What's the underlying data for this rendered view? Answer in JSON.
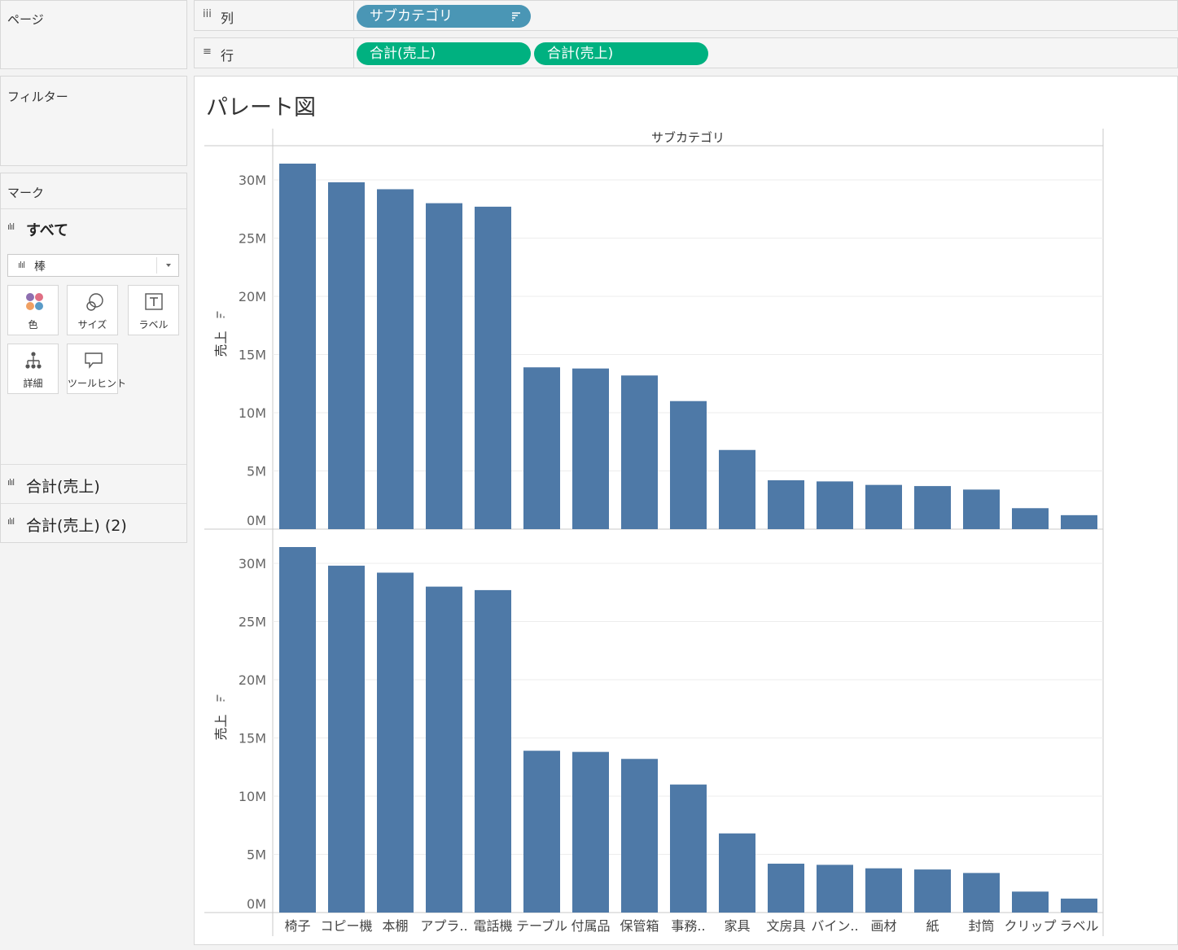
{
  "pages_panel": {
    "title": "ページ"
  },
  "filters_panel": {
    "title": "フィルター"
  },
  "marks_panel": {
    "title": "マーク",
    "all_label": "すべて",
    "mark_type": "棒",
    "buttons": [
      {
        "label": "色",
        "icon": "color-icon"
      },
      {
        "label": "サイズ",
        "icon": "size-icon"
      },
      {
        "label": "ラベル",
        "icon": "label-icon"
      },
      {
        "label": "詳細",
        "icon": "detail-icon"
      },
      {
        "label": "ツールヒント",
        "icon": "tooltip-icon"
      }
    ],
    "measure_cards": [
      "合計(売上)",
      "合計(売上) (2)"
    ]
  },
  "columns_shelf": {
    "label": "列",
    "pills": [
      "サブカテゴリ"
    ]
  },
  "rows_shelf": {
    "label": "行",
    "pills": [
      "合計(売上)",
      "合計(売上)"
    ]
  },
  "sheet_title": "パレート図",
  "colors": {
    "bar": "#4e79a7",
    "pill_dim": "#4a96b5",
    "pill_measure": "#00b180"
  },
  "chart_data": {
    "type": "bar",
    "header": "サブカテゴリ",
    "categories": [
      "椅子",
      "コピー機",
      "本棚",
      "アプラ..",
      "電話機",
      "テーブル",
      "付属品",
      "保管箱",
      "事務..",
      "家具",
      "文房具",
      "バイン..",
      "画材",
      "紙",
      "封筒",
      "クリップ",
      "ラベル"
    ],
    "series": [
      {
        "values": [
          31.4,
          29.8,
          29.2,
          28.0,
          27.7,
          13.9,
          13.8,
          13.2,
          11.0,
          6.8,
          4.2,
          4.1,
          3.8,
          3.7,
          3.4,
          1.8,
          1.2
        ]
      },
      {
        "values": [
          31.4,
          29.8,
          29.2,
          28.0,
          27.7,
          13.9,
          13.8,
          13.2,
          11.0,
          6.8,
          4.2,
          4.1,
          3.8,
          3.7,
          3.4,
          1.8,
          1.2
        ]
      }
    ],
    "ylabel": "売上",
    "yticks": [
      "0M",
      "5M",
      "10M",
      "15M",
      "20M",
      "25M",
      "30M"
    ],
    "ylim": [
      0,
      31.4
    ],
    "grid": true
  }
}
